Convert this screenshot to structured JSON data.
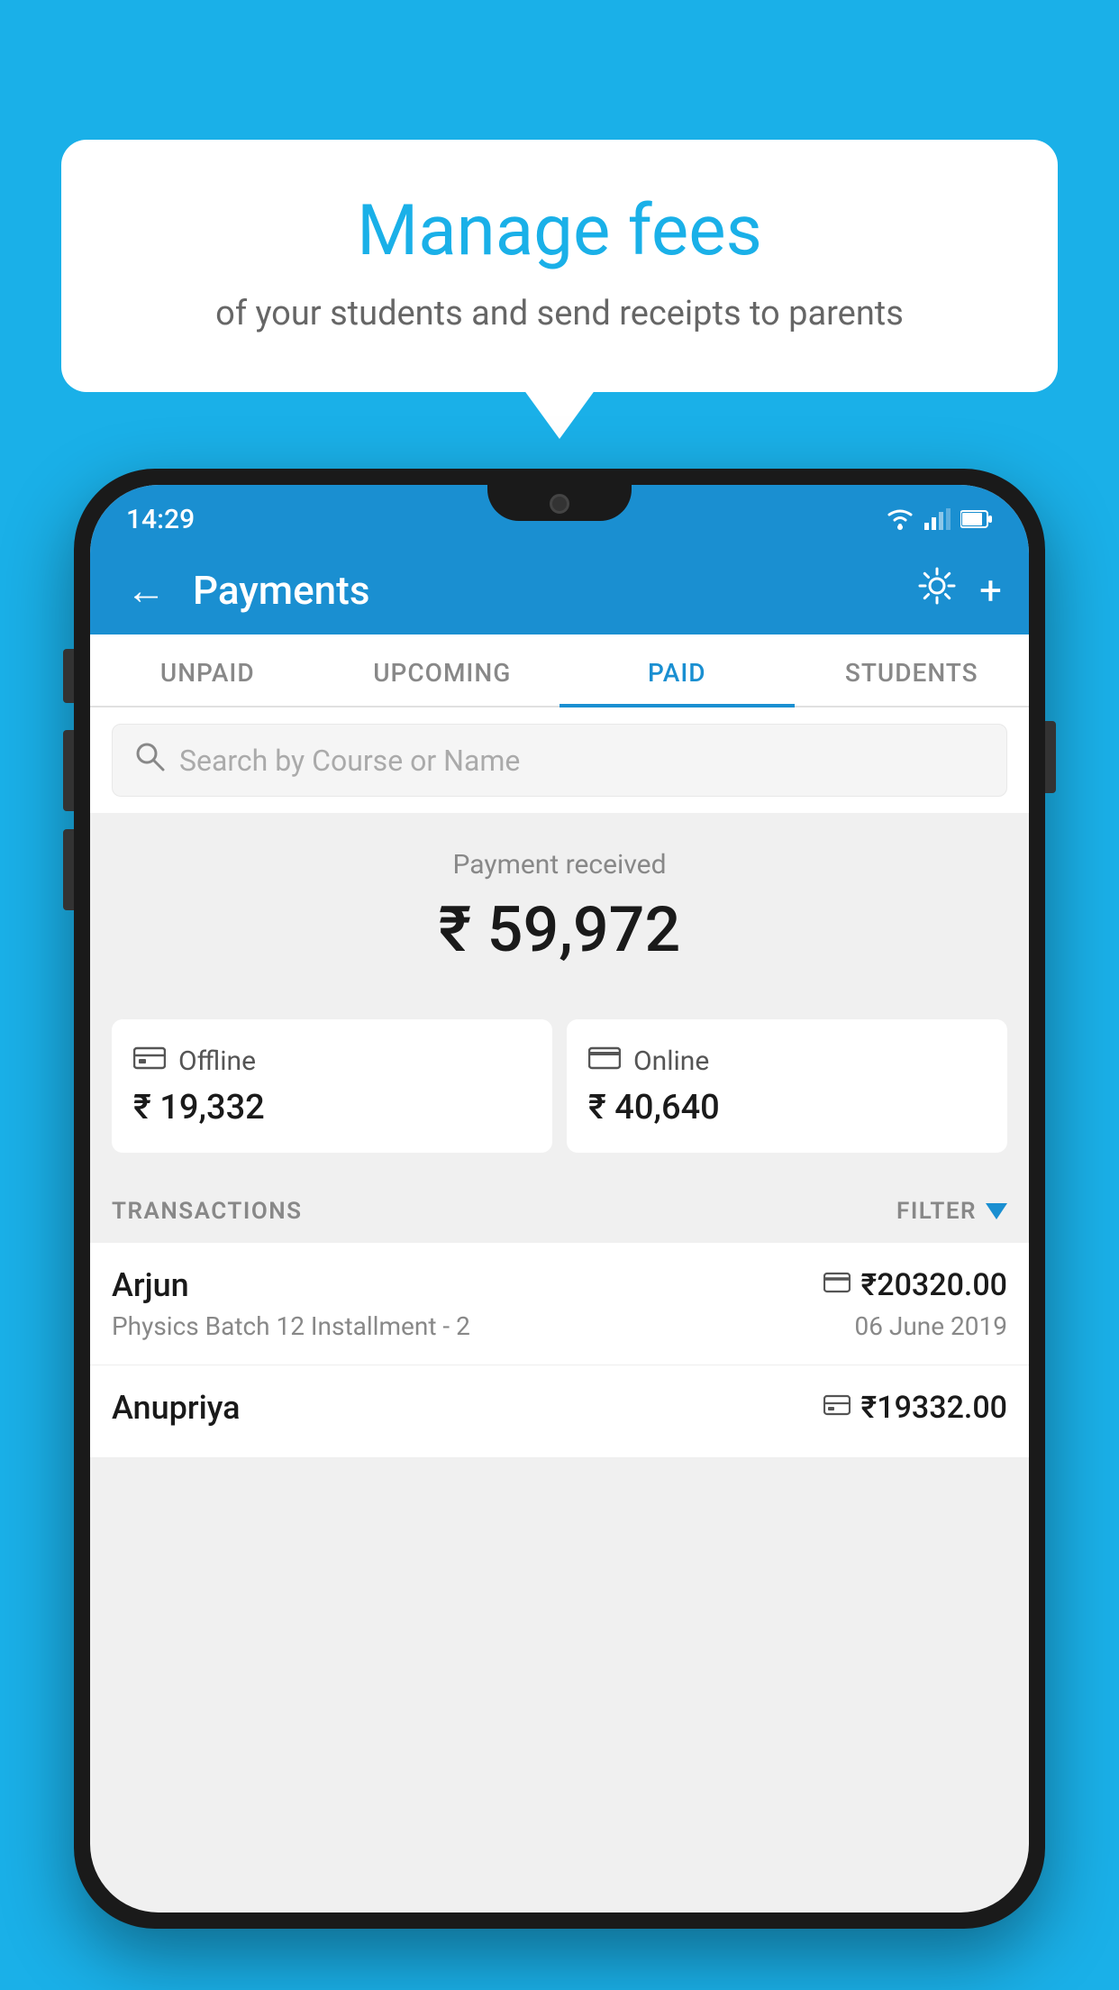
{
  "background_color": "#1ab0e8",
  "bubble": {
    "title": "Manage fees",
    "subtitle": "of your students and send receipts to parents"
  },
  "status_bar": {
    "time": "14:29"
  },
  "header": {
    "title": "Payments",
    "back_label": "←",
    "plus_label": "+"
  },
  "tabs": [
    {
      "label": "UNPAID",
      "active": false
    },
    {
      "label": "UPCOMING",
      "active": false
    },
    {
      "label": "PAID",
      "active": true
    },
    {
      "label": "STUDENTS",
      "active": false
    }
  ],
  "search": {
    "placeholder": "Search by Course or Name"
  },
  "payment_summary": {
    "label": "Payment received",
    "amount": "₹ 59,972"
  },
  "payment_methods": [
    {
      "type": "Offline",
      "amount": "₹ 19,332",
      "icon": "💳"
    },
    {
      "type": "Online",
      "amount": "₹ 40,640",
      "icon": "💳"
    }
  ],
  "transactions_label": "TRANSACTIONS",
  "filter_label": "FILTER",
  "transactions": [
    {
      "name": "Arjun",
      "course": "Physics Batch 12 Installment - 2",
      "amount": "₹20320.00",
      "date": "06 June 2019",
      "payment_type": "online"
    },
    {
      "name": "Anupriya",
      "course": "",
      "amount": "₹19332.00",
      "date": "",
      "payment_type": "offline"
    }
  ]
}
